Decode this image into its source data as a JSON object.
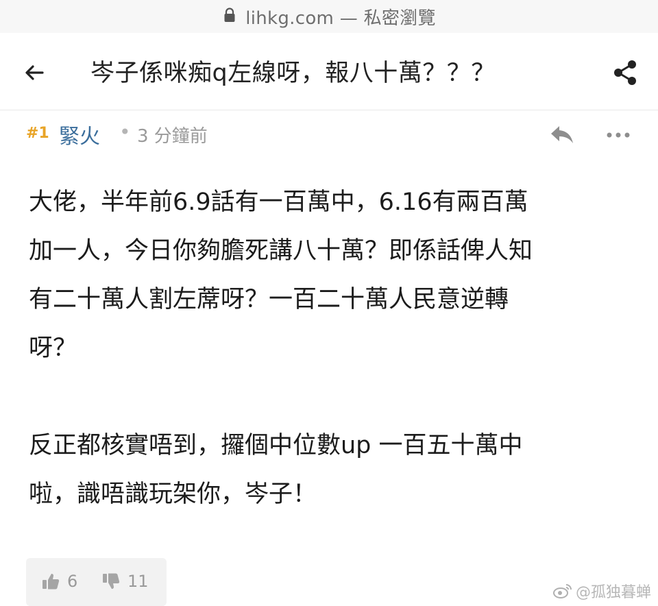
{
  "browser": {
    "url_text": "lihkg.com — 私密瀏覽"
  },
  "thread": {
    "title": "岑子係咪痴q左線呀，報八十萬？？？"
  },
  "post": {
    "floor": "#1",
    "username": "緊火",
    "separator": "•",
    "time": "3 分鐘前",
    "paragraphs": [
      {
        "lines": [
          "大佬，半年前6.9話有一百萬中，6.16有兩百萬",
          "加一人，今日你夠膽死講八十萬？即係話俾人知",
          "有二十萬人割左蓆呀？一百二十萬人民意逆轉",
          "呀？"
        ]
      },
      {
        "lines": [
          "反正都核實唔到，攞個中位數up 一百五十萬中",
          "啦，識唔識玩架你，岑子！"
        ]
      }
    ],
    "likes": "6",
    "dislikes": "11"
  },
  "watermark": {
    "text": "@孤独暮蝉"
  },
  "colors": {
    "floor": "#e8a427",
    "username": "#3b6e9c",
    "meta_gray": "#9a9a9a",
    "vote_bg": "#f2f2f2"
  },
  "icons": {
    "lock": "lock-icon",
    "back": "arrow-left-icon",
    "share": "share-icon",
    "reply": "reply-icon",
    "more": "more-horizontal-icon",
    "like": "thumbs-up-icon",
    "dislike": "thumbs-down-icon",
    "weibo": "weibo-logo-icon"
  }
}
